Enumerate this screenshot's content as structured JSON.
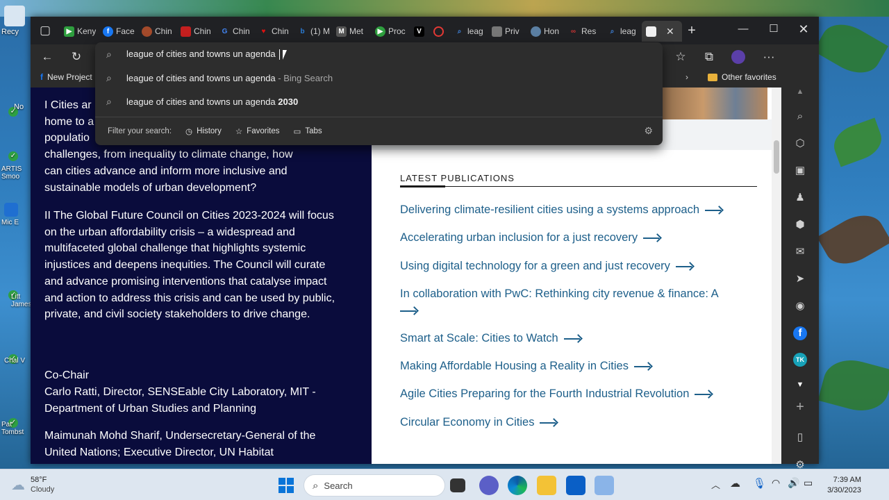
{
  "desktop": {
    "icons": [
      {
        "label": "Recy"
      },
      {
        "label": "No"
      },
      {
        "label": "ARTIS Smoo"
      },
      {
        "label": "Mic E"
      },
      {
        "label": "Litt James"
      },
      {
        "label": "Chal V"
      },
      {
        "label": "Pat Tombst"
      }
    ]
  },
  "tabs": [
    {
      "label": "Keny",
      "icon": "play-icon",
      "color": "#2e9e3e"
    },
    {
      "label": "Face",
      "icon": "facebook-icon",
      "color": "#1877f2"
    },
    {
      "label": "Chin",
      "icon": "chin-icon",
      "color": "#a34a2b"
    },
    {
      "label": "Chin",
      "icon": "chin-icon",
      "color": "#c41f1f"
    },
    {
      "label": "Chin",
      "icon": "google-icon",
      "color": "#4285f4"
    },
    {
      "label": "Chin",
      "icon": "heart-icon",
      "color": "#d11"
    },
    {
      "label": "(1) M",
      "icon": "bing-icon",
      "color": "#2b7bd4"
    },
    {
      "label": "Met",
      "icon": "met-icon",
      "color": "#555"
    },
    {
      "label": "Proc",
      "icon": "play-icon",
      "color": "#2e9e3e"
    },
    {
      "label": "V",
      "icon": "v-icon",
      "color": "#000"
    },
    {
      "label": "",
      "icon": "record-icon",
      "color": "#e53935"
    },
    {
      "label": "leag",
      "icon": "search-icon",
      "color": "#3d7fd6"
    },
    {
      "label": "Priv",
      "icon": "image-icon",
      "color": "#777"
    },
    {
      "label": "Hon",
      "icon": "globe-icon",
      "color": "#5b7fa3"
    },
    {
      "label": "Res",
      "icon": "res-icon",
      "color": "#c33"
    },
    {
      "label": "leag",
      "icon": "search-icon",
      "color": "#3d7fd6"
    }
  ],
  "address": {
    "query": "league of cities and towns un agenda"
  },
  "suggestions": [
    {
      "text": "league of cities and towns un agenda",
      "suffix": " - Bing Search",
      "bold": ""
    },
    {
      "text": "league of cities and towns un agenda ",
      "suffix": "",
      "bold": "2030"
    }
  ],
  "filter": {
    "label": "Filter your search:",
    "history": "History",
    "favorites": "Favorites",
    "tabs": "Tabs"
  },
  "favbar": {
    "first": "New Project",
    "other": "Other favorites"
  },
  "left": {
    "p1": "I Cities are home to a growing share of the world's population. In the face of mounting challenges, from inequality to climate change, how can cities advance and inform more inclusive and sustainable models of urban development?",
    "p1_visible_start": "I Cities ar",
    "p1_line2": "home to a",
    "p1_line3": "populatio",
    "p1_line4": "challenges, from inequality to climate change, how",
    "p1_line5": "can cities advance and inform more inclusive and",
    "p1_line6": "sustainable models of urban development?",
    "p2": "II The Global Future Council on Cities 2023-2024 will focus on the urban affordability crisis – a widespread and multifaceted global challenge that highlights systemic injustices and deepens inequities. The Council will curate and advance promising interventions that catalyse impact and action to address this crisis and can be used by public, private, and civil society stakeholders to drive change.",
    "cochair_label": "Co-Chair",
    "cochair1": "Carlo Ratti, Director, SENSEable City Laboratory, MIT - Department of Urban Studies and Planning",
    "cochair2": "Maimunah Mohd Sharif, Undersecretary-General of the United Nations; Executive Director, UN Habitat"
  },
  "publications": {
    "heading": "LATEST PUBLICATIONS",
    "items": [
      "Delivering climate-resilient cities using a systems approach",
      "Accelerating urban inclusion for a just recovery",
      "Using digital technology for a green and just recovery",
      "In collaboration with PwC: Rethinking city revenue & finance: A",
      "Smart at Scale: Cities to Watch",
      "Making Affordable Housing a Reality in Cities",
      "Agile Cities Preparing for the Fourth Industrial Revolution",
      "Circular Economy in Cities"
    ]
  },
  "taskbar": {
    "weather_temp": "58°F",
    "weather_desc": "Cloudy",
    "search": "Search",
    "time": "7:39 AM",
    "date": "3/30/2023"
  }
}
